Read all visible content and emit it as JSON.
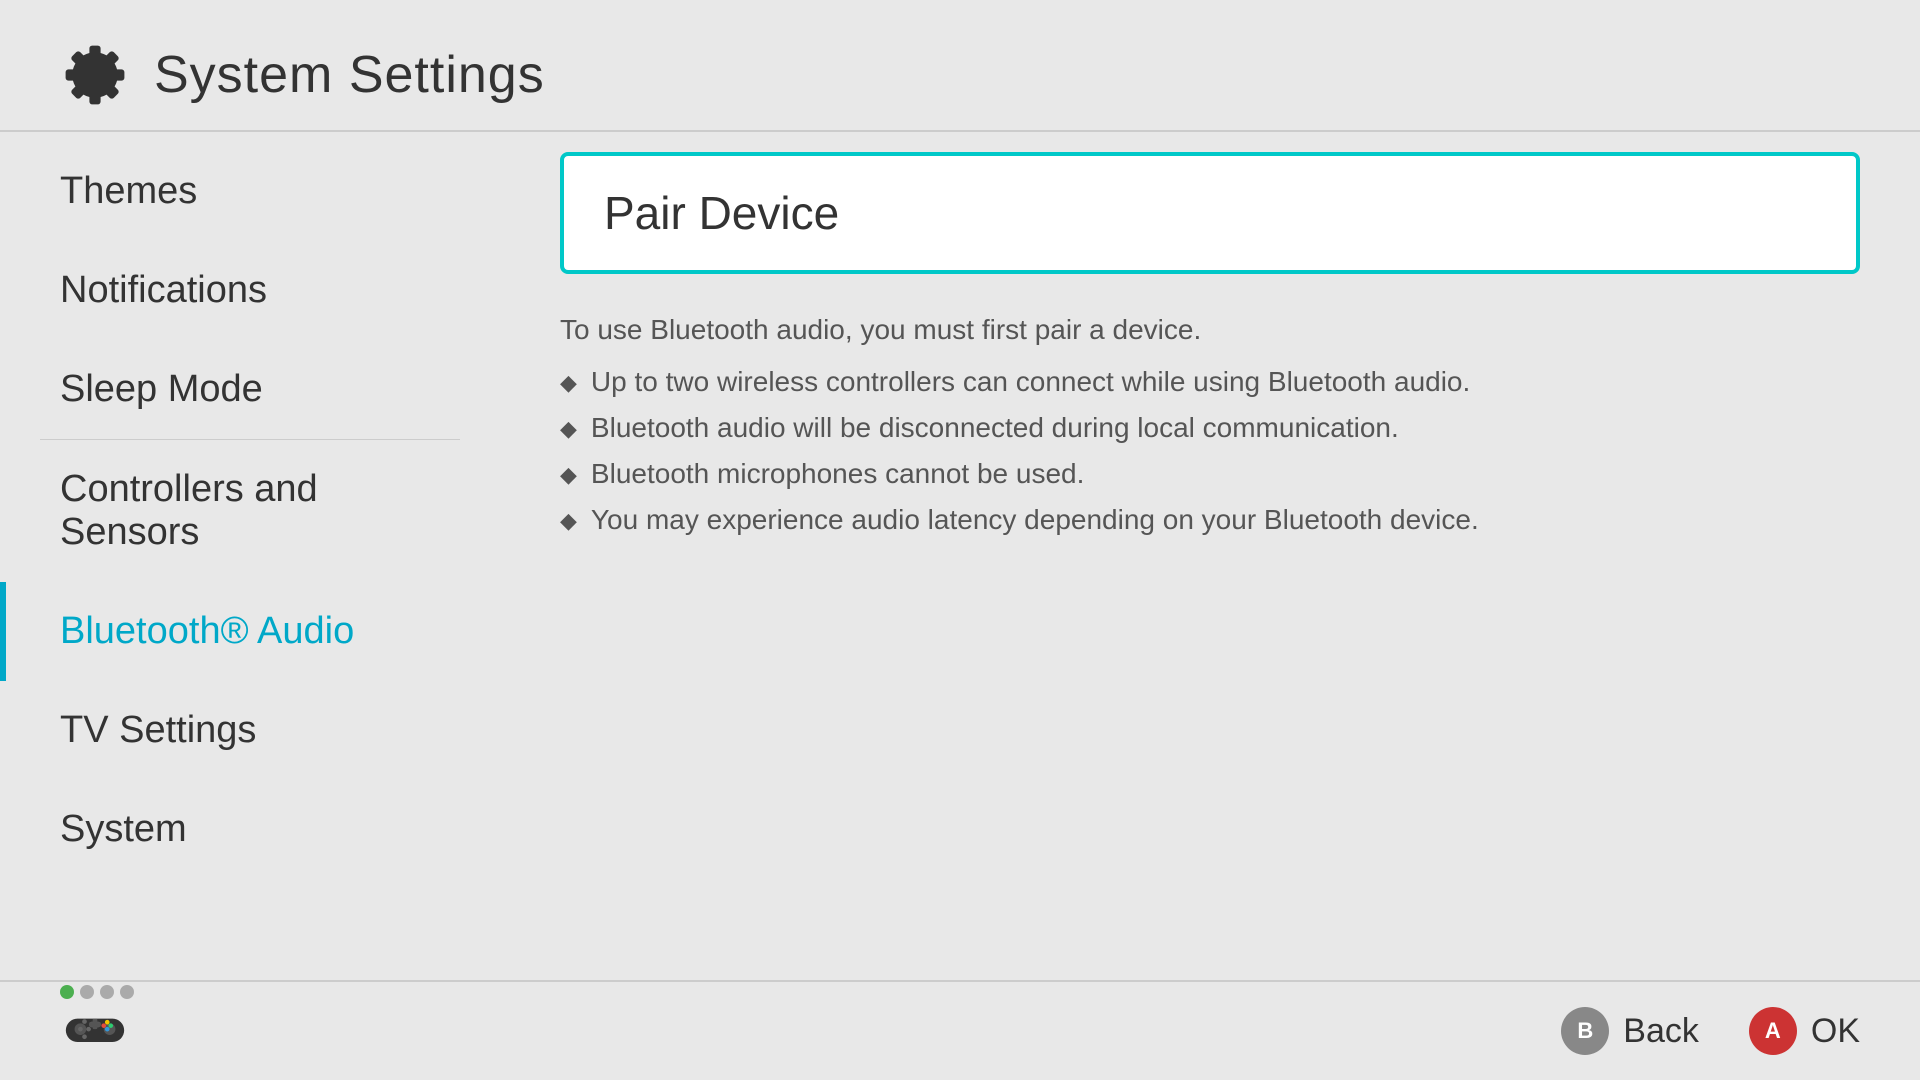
{
  "header": {
    "title": "System Settings"
  },
  "sidebar": {
    "items": [
      {
        "id": "themes",
        "label": "Themes",
        "active": false,
        "hasDividerAfter": false
      },
      {
        "id": "notifications",
        "label": "Notifications",
        "active": false,
        "hasDividerAfter": false
      },
      {
        "id": "sleep-mode",
        "label": "Sleep Mode",
        "active": false,
        "hasDividerAfter": true
      },
      {
        "id": "controllers-and-sensors",
        "label": "Controllers and Sensors",
        "active": false,
        "hasDividerAfter": false
      },
      {
        "id": "bluetooth-audio",
        "label": "Bluetooth® Audio",
        "active": true,
        "hasDividerAfter": false
      },
      {
        "id": "tv-settings",
        "label": "TV Settings",
        "active": false,
        "hasDividerAfter": false
      },
      {
        "id": "system",
        "label": "System",
        "active": false,
        "hasDividerAfter": false
      }
    ]
  },
  "content": {
    "pair_device": {
      "title": "Pair Device"
    },
    "description": "To use Bluetooth audio, you must first pair a device.",
    "bullets": [
      "Up to two wireless controllers can connect while using Bluetooth audio.",
      "Bluetooth audio will be disconnected during local communication.",
      "Bluetooth microphones cannot be used.",
      "You may experience audio latency depending on your Bluetooth device."
    ]
  },
  "footer": {
    "dots": [
      {
        "active": true
      },
      {
        "active": false
      },
      {
        "active": false
      },
      {
        "active": false
      }
    ],
    "buttons": [
      {
        "id": "back",
        "circle_label": "B",
        "label": "Back"
      },
      {
        "id": "ok",
        "circle_label": "A",
        "label": "OK"
      }
    ]
  }
}
